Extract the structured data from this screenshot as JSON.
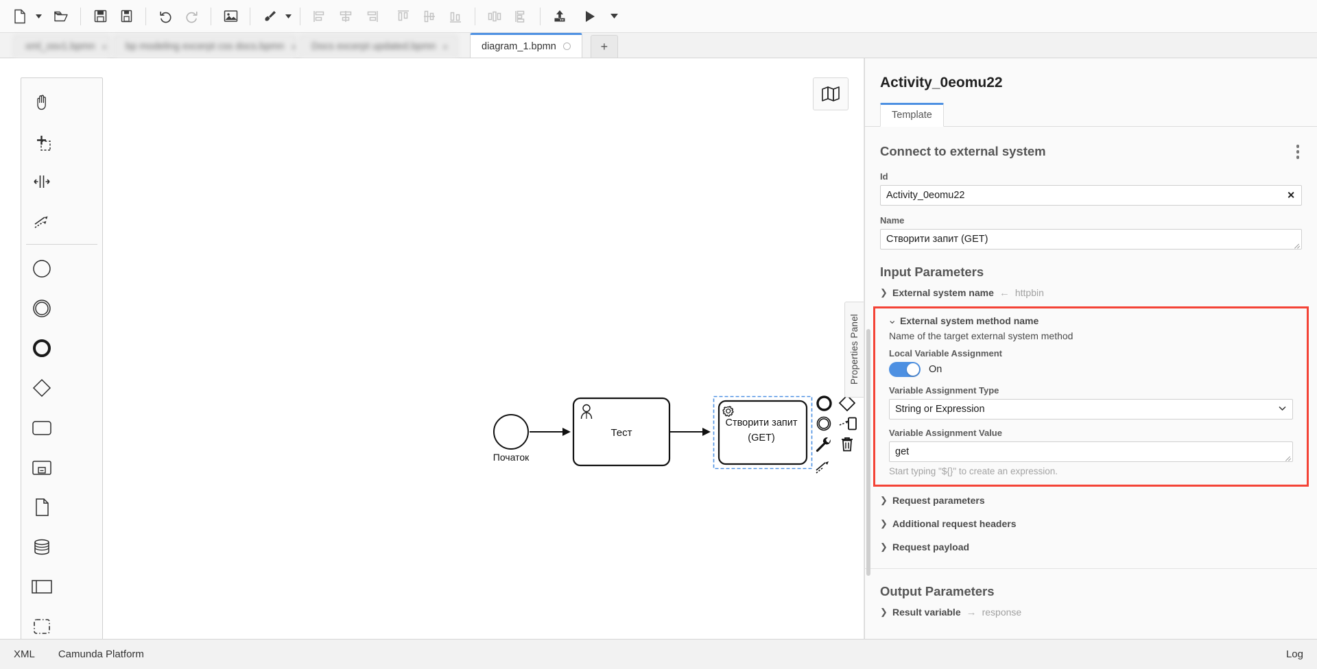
{
  "toolbar": {
    "buttons": [
      {
        "name": "new-file-icon",
        "glyph": "file"
      },
      {
        "name": "new-file-dropdown-caret",
        "glyph": "caret"
      },
      {
        "name": "open-file-icon",
        "glyph": "folder"
      },
      {
        "name": "save-icon",
        "glyph": "save"
      },
      {
        "name": "save-as-icon",
        "glyph": "save-as"
      },
      {
        "name": "undo-icon",
        "glyph": "undo"
      },
      {
        "name": "redo-icon",
        "glyph": "redo"
      },
      {
        "name": "export-image-icon",
        "glyph": "image"
      },
      {
        "name": "align-tool-icon",
        "glyph": "brush"
      },
      {
        "name": "align-tool-dropdown-caret",
        "glyph": "caret"
      },
      {
        "name": "align-left-icon",
        "glyph": "align-left"
      },
      {
        "name": "align-center-horizontal-icon",
        "glyph": "align-center-h"
      },
      {
        "name": "align-right-icon",
        "glyph": "align-right"
      },
      {
        "name": "align-top-icon",
        "glyph": "align-top"
      },
      {
        "name": "align-middle-icon",
        "glyph": "align-middle"
      },
      {
        "name": "align-bottom-icon",
        "glyph": "align-bottom"
      },
      {
        "name": "distribute-horizontal-icon",
        "glyph": "dist-h"
      },
      {
        "name": "distribute-vertical-icon",
        "glyph": "dist-v"
      },
      {
        "name": "deploy-icon",
        "glyph": "deploy"
      },
      {
        "name": "start-instance-icon",
        "glyph": "play"
      },
      {
        "name": "start-instance-dropdown-caret",
        "glyph": "caret"
      }
    ]
  },
  "tabs": {
    "items": [
      {
        "label": "xml_osv1.bpmn",
        "active": false,
        "blurred": true,
        "close": "×"
      },
      {
        "label": "bp modeling excerpt css docs.bpmn",
        "active": false,
        "blurred": true,
        "close": "×"
      },
      {
        "label": "Docs excerpt updated.bpmn",
        "active": false,
        "blurred": true,
        "close": "×"
      },
      {
        "label": "diagram_1.bpmn",
        "active": true,
        "blurred": false,
        "close": ""
      }
    ],
    "add_label": "+"
  },
  "palette": {
    "items": [
      {
        "name": "hand-tool-icon"
      },
      {
        "name": "lasso-tool-icon"
      },
      {
        "name": "space-tool-icon"
      },
      {
        "name": "connect-tool-icon"
      },
      {
        "name": "start-event-icon"
      },
      {
        "name": "intermediate-event-icon"
      },
      {
        "name": "end-event-icon"
      },
      {
        "name": "gateway-icon"
      },
      {
        "name": "task-icon"
      },
      {
        "name": "subprocess-expanded-icon"
      },
      {
        "name": "data-object-icon"
      },
      {
        "name": "data-store-icon"
      },
      {
        "name": "participant-pool-icon"
      },
      {
        "name": "create-group-icon"
      }
    ]
  },
  "canvas": {
    "minimap_label": "minimap",
    "properties_panel_handle": "Properties Panel",
    "diagram": {
      "start_event_label": "Початок",
      "user_task_label": "Тест",
      "service_task_label_line1": "Створити запит",
      "service_task_label_line2": "(GET)"
    },
    "context_pad": [
      {
        "name": "append-end-event-icon"
      },
      {
        "name": "append-intermediate-event-icon"
      },
      {
        "name": "append-gateway-icon"
      },
      {
        "name": "append-task-icon"
      },
      {
        "name": "change-type-wrench-icon"
      },
      {
        "name": "delete-trash-icon"
      },
      {
        "name": "connect-icon"
      }
    ]
  },
  "properties": {
    "title": "Activity_0eomu22",
    "tabs": [
      {
        "label": "Template",
        "active": true
      }
    ],
    "group_title": "Connect to external system",
    "kebab_name": "template-options-menu",
    "id_field": {
      "label": "Id",
      "value": "Activity_0eomu22",
      "clear": "✕"
    },
    "name_field": {
      "label": "Name",
      "value": "Створити запит (GET)"
    },
    "input_parameters": {
      "section_title": "Input Parameters",
      "entries": [
        {
          "label": "External system name",
          "arrow": "←",
          "value": "httpbin",
          "chev": "❯",
          "expanded": false
        }
      ],
      "highlighted": {
        "chev": "⌄",
        "label": "External system method name",
        "description": "Name of the target external system method",
        "toggle_label": "Local Variable Assignment",
        "toggle_state": "On",
        "toggle_color": "#4d90e2",
        "type_label": "Variable Assignment Type",
        "type_value": "String or Expression",
        "value_label": "Variable Assignment Value",
        "value_value": "get",
        "hint": "Start typing \"${}\" to create an expression.",
        "highlight_color": "#f44336"
      },
      "collapsed_entries": [
        {
          "label": "Request parameters",
          "chev": "❯"
        },
        {
          "label": "Additional request headers",
          "chev": "❯"
        },
        {
          "label": "Request payload",
          "chev": "❯"
        }
      ]
    },
    "output_parameters": {
      "section_title": "Output Parameters",
      "entries": [
        {
          "label": "Result variable",
          "arrow": "→",
          "value": "response",
          "chev": "❯"
        }
      ]
    }
  },
  "statusbar": {
    "left_items": [
      "XML",
      "Camunda Platform"
    ],
    "right_item": "Log"
  }
}
